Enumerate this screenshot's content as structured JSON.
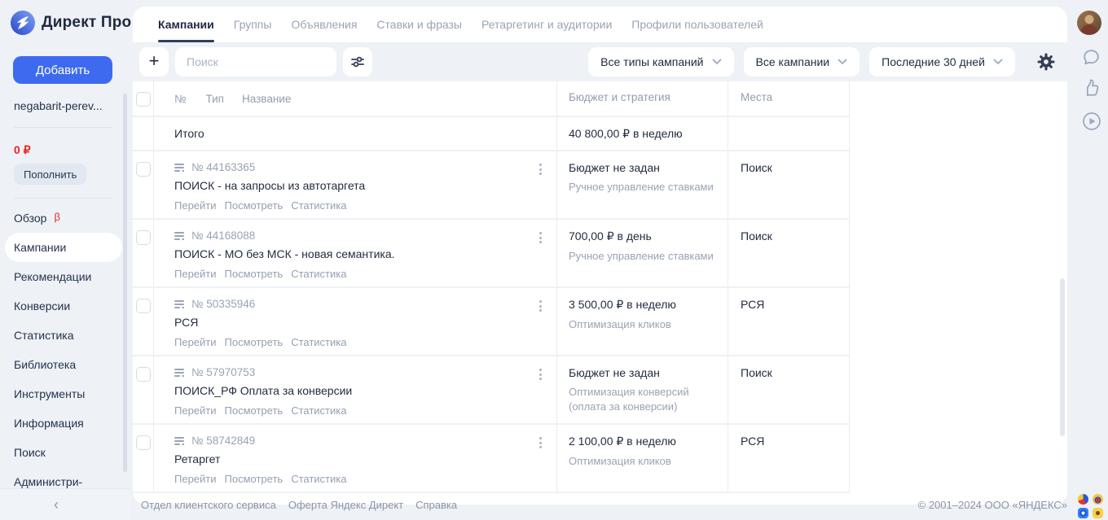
{
  "brand": {
    "title": "Директ Про",
    "logo_icon": "direct-logo-icon"
  },
  "tabs": [
    {
      "label": "Кампании",
      "active": true
    },
    {
      "label": "Группы"
    },
    {
      "label": "Объявления"
    },
    {
      "label": "Ставки и фразы"
    },
    {
      "label": "Ретаргетинг и аудитории"
    },
    {
      "label": "Профили пользователей"
    }
  ],
  "sidebar": {
    "add_button": "Добавить",
    "account_name": "negabarit-perev...",
    "balance": "0 ₽",
    "topup_button": "Пополнить",
    "menu": [
      {
        "label": "Обзор",
        "badge": "β"
      },
      {
        "label": "Кампании",
        "active": true
      },
      {
        "label": "Рекомендации"
      },
      {
        "label": "Конверсии"
      },
      {
        "label": "Статистика"
      },
      {
        "label": "Библиотека"
      },
      {
        "label": "Инструменты"
      },
      {
        "label": "Информация"
      },
      {
        "label": "Поиск"
      },
      {
        "label": "Администри-"
      }
    ],
    "collapse": "‹"
  },
  "toolbar": {
    "add": "+",
    "search_placeholder": "Поиск",
    "filters": {
      "campaign_types": "Все типы кампаний",
      "campaigns": "Все кампании",
      "period": "Последние 30 дней"
    },
    "icons": [
      "plus-icon",
      "sliders-icon",
      "gear-icon",
      "chevron-down-icon"
    ]
  },
  "table": {
    "headers": {
      "number": "№",
      "type": "Тип",
      "name": "Название",
      "budget": "Бюджет и стратегия",
      "places": "Места"
    },
    "total": {
      "label": "Итого",
      "budget": "40 800,00 ₽ в неделю"
    },
    "row_links": [
      "Перейти",
      "Посмотреть",
      "Статистика"
    ],
    "rows": [
      {
        "number": "№ 44163365",
        "name": "ПОИСК - на запросы из автотаргета",
        "budget": "Бюджет не задан",
        "strategy": "Ручное управление ставками",
        "places": "Поиск"
      },
      {
        "number": "№ 44168088",
        "name": "ПОИСК - МО без МСК - новая семантика.",
        "budget": "700,00 ₽ в день",
        "strategy": "Ручное управление ставками",
        "places": "Поиск"
      },
      {
        "number": "№ 50335946",
        "name": "РСЯ",
        "budget": "3 500,00 ₽ в неделю",
        "strategy": "Оптимизация кликов",
        "places": "РСЯ"
      },
      {
        "number": "№ 57970753",
        "name": "ПОИСК_РФ Оплата за конверсии",
        "budget": "Бюджет не задан",
        "strategy": "Оптимизация конверсий (оплата за конверсии)",
        "places": "Поиск"
      },
      {
        "number": "№ 58742849",
        "name": "Ретаргет",
        "budget": "2 100,00 ₽ в неделю",
        "strategy": "Оптимизация кликов",
        "places": "РСЯ"
      }
    ]
  },
  "rail": {
    "icons": [
      "user-avatar",
      "chat-bubble-icon",
      "thumbs-up-icon",
      "play-circle-icon"
    ]
  },
  "footer": {
    "links": [
      "Отдел клиентского сервиса",
      "Оферта Яндекс Директ",
      "Справка"
    ],
    "copyright": "© 2001–2024 ООО «ЯНДЕКС»"
  },
  "colors": {
    "accent": "#3e6af0",
    "alert": "#e02a22",
    "page_bg": "#eef1f6",
    "text_dark": "#222c40",
    "text_muted": "#98a2b4"
  }
}
